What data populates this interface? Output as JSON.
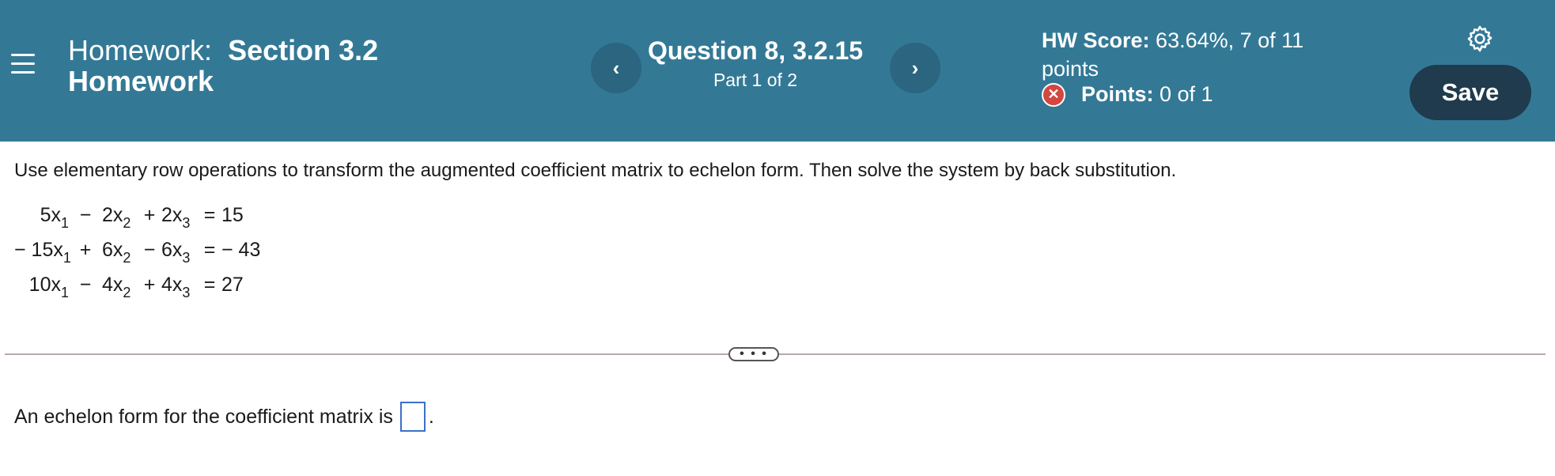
{
  "header": {
    "menu_icon": "hamburger-menu-icon",
    "hw_label": "Homework:",
    "hw_section": "Section 3.2",
    "hw_section_line2": "Homework",
    "prev_label": "‹",
    "next_label": "›",
    "question_title": "Question 8, 3.2.15",
    "question_part": "Part 1 of 2",
    "score_label": "HW Score:",
    "score_value": "63.64%, 7 of 11",
    "score_value_line2": "points",
    "points_label": "Points:",
    "points_value": "0 of 1",
    "points_status_icon": "incorrect-x-icon",
    "gear_icon": "gear-icon",
    "save_label": "Save",
    "colors": {
      "header_bg": "#337996",
      "nav_btn": "#2b6580",
      "save_btn": "#1f3b4d",
      "incorrect": "#d2473f"
    }
  },
  "main": {
    "instructions": "Use elementary row operations to transform the augmented coefficient matrix to echelon form. Then solve the system by back substitution.",
    "equations": [
      {
        "c1": "5x",
        "s1": "1",
        "op1": "−",
        "c2": "2x",
        "s2": "2",
        "op2": "+",
        "c3": "2x",
        "s3": "3",
        "eq": "=",
        "rhs": "15"
      },
      {
        "c1": "− 15x",
        "s1": "1",
        "op1": "+",
        "c2": "6x",
        "s2": "2",
        "op2": "−",
        "c3": "6x",
        "s3": "3",
        "eq": "=",
        "rhs": "− 43"
      },
      {
        "c1": "10x",
        "s1": "1",
        "op1": "−",
        "c2": "4x",
        "s2": "2",
        "op2": "+",
        "c3": "4x",
        "s3": "3",
        "eq": "=",
        "rhs": "27"
      }
    ],
    "divider_handle": "• • •",
    "answer_prefix": "An echelon form for the coefficient matrix is",
    "answer_suffix": "."
  }
}
